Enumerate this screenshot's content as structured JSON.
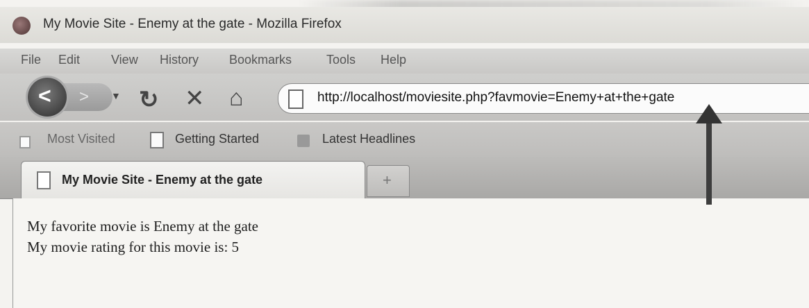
{
  "window": {
    "title": "My Movie Site - Enemy at the gate - Mozilla Firefox"
  },
  "menu": {
    "items": [
      "File",
      "Edit",
      "View",
      "History",
      "Bookmarks",
      "Tools",
      "Help"
    ]
  },
  "toolbar": {
    "back_label": "<",
    "forward_label": ">",
    "icons": [
      "reload-icon",
      "stop-icon",
      "home-icon"
    ],
    "url": "http://localhost/moviesite.php?favmovie=Enemy+at+the+gate"
  },
  "bookmarks": {
    "items": [
      "Most Visited",
      "Getting Started",
      "Latest Headlines"
    ]
  },
  "tabs": [
    {
      "title": "My Movie Site - Enemy at the gate"
    }
  ],
  "newtab_label": "+",
  "content": {
    "line1": "My favorite movie is Enemy at the gate",
    "line2": "My movie rating for this movie is: 5"
  }
}
